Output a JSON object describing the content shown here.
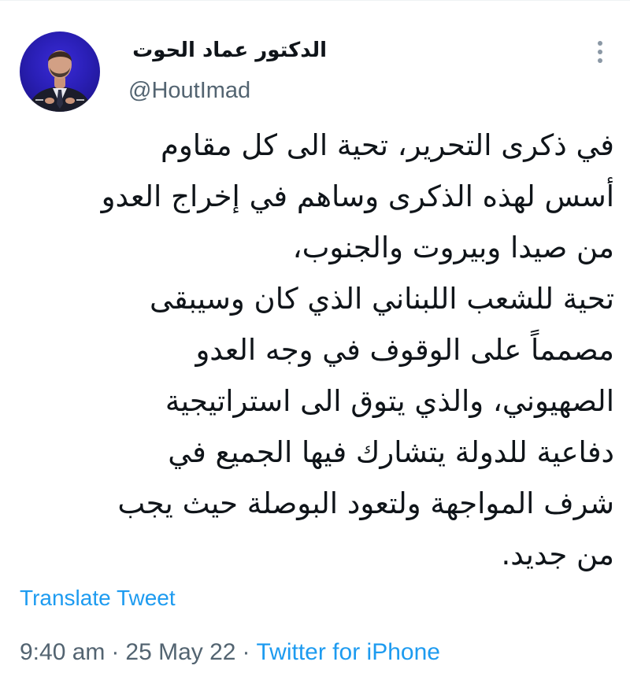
{
  "author": {
    "display_name": "الدكتور عماد الحوت",
    "handle": "@HoutImad"
  },
  "tweet": {
    "lines": [
      "في ذكرى التحرير، تحية الى كل مقاوم",
      "أسس لهذه الذكرى وساهم في إخراج العدو",
      "من صيدا وبيروت والجنوب،",
      "تحية للشعب اللبناني الذي كان وسيبقى",
      "مصمماً على الوقوف في وجه العدو",
      "الصهيوني، والذي يتوق الى استراتيجية",
      "دفاعية للدولة يتشارك فيها الجميع في",
      "شرف المواجهة ولتعود البوصلة حيث يجب",
      "من جديد."
    ],
    "translate_label": "Translate Tweet"
  },
  "meta": {
    "time": "9:40 am",
    "separator": "·",
    "date": "25 May 22",
    "source": "Twitter for iPhone"
  },
  "icons": {
    "more": "more-vertical-icon",
    "avatar": "avatar-photo"
  },
  "colors": {
    "text": "#0f1419",
    "secondary": "#536471",
    "link": "#1d9bf0",
    "avatar_background": "#2a1fb6"
  }
}
